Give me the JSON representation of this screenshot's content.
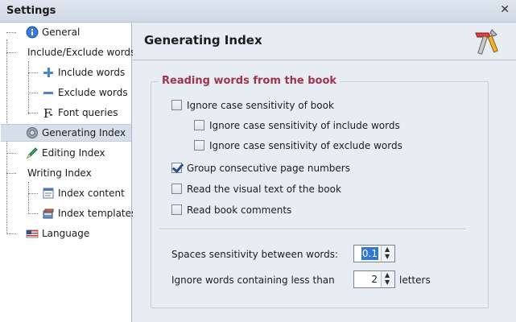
{
  "window": {
    "title": "Settings",
    "close_glyph": "✕"
  },
  "sidebar": {
    "items": [
      {
        "label": "General",
        "icon": "info-icon"
      },
      {
        "label": "Include/Exclude words",
        "icon": ""
      },
      {
        "label": "Include words",
        "icon": "plus-icon"
      },
      {
        "label": "Exclude words",
        "icon": "minus-icon"
      },
      {
        "label": "Font queries",
        "icon": "font-icon"
      },
      {
        "label": "Generating Index",
        "icon": "gear-icon",
        "selected": true
      },
      {
        "label": "Editing Index",
        "icon": "pencil-icon"
      },
      {
        "label": "Writing Index",
        "icon": ""
      },
      {
        "label": "Index content",
        "icon": "document-icon"
      },
      {
        "label": "Index templates",
        "icon": "books-icon"
      },
      {
        "label": "Language",
        "icon": "flag-icon"
      }
    ]
  },
  "page": {
    "title": "Generating Index",
    "header_icon": "tools-icon",
    "group_title": "Reading words from the book",
    "options": [
      {
        "label": "Ignore case sensitivity of book",
        "checked": false
      },
      {
        "label": "Ignore case sensitivity of include words",
        "checked": false
      },
      {
        "label": "Ignore case sensitivity of exclude words",
        "checked": false
      },
      {
        "label": "Group consecutive page numbers",
        "checked": true
      },
      {
        "label": "Read the visual text of the book",
        "checked": false
      },
      {
        "label": "Read book comments",
        "checked": false
      }
    ],
    "spaces_sensitivity": {
      "label": "Spaces sensitivity between words:",
      "value": "0.1"
    },
    "ignore_words": {
      "label": "Ignore words containing less than",
      "value": "2",
      "suffix": "letters"
    }
  },
  "colors": {
    "accent_red": "#a0344b",
    "selection": "#d6dee9",
    "check": "#2a4f8f"
  }
}
